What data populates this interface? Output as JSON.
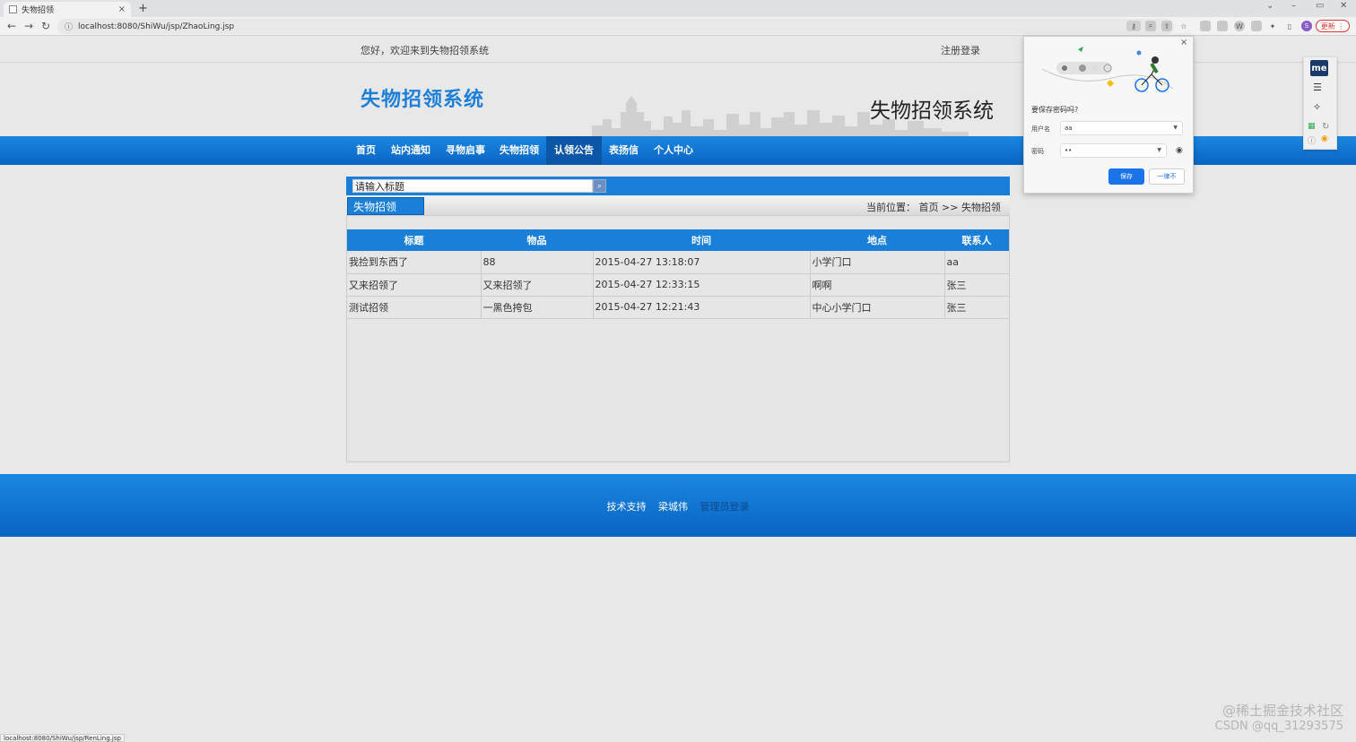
{
  "browser": {
    "tab_title": "失物招领",
    "new_tab": "+",
    "close_tab": "×",
    "window_controls": [
      "⌄",
      "–",
      "▭",
      "✕"
    ],
    "url": "localhost:8080/ShiWu/jsp/ZhaoLing.jsp",
    "update_label": "更新",
    "profile_initial": "S",
    "status_url": "localhost:8080/ShiWu/jsp/RenLing.jsp"
  },
  "header": {
    "welcome": "您好，欢迎来到失物招领系统",
    "register_login": "注册登录",
    "logo": "失物招领系统",
    "banner_title": "失物招领系统"
  },
  "nav": {
    "items": [
      {
        "label": "首页"
      },
      {
        "label": "站内通知"
      },
      {
        "label": "寻物启事"
      },
      {
        "label": "失物招领"
      },
      {
        "label": "认领公告"
      },
      {
        "label": "表扬信"
      },
      {
        "label": "个人中心"
      }
    ],
    "active": "认领公告"
  },
  "search": {
    "value": "请输入标题",
    "button_icon": "search-icon"
  },
  "section": {
    "title": "失物招领",
    "breadcrumb_label": "当前位置：",
    "breadcrumb_home": "首页",
    "breadcrumb_sep": ">>",
    "breadcrumb_current": "失物招领"
  },
  "table": {
    "headers": [
      "标题",
      "物品",
      "时间",
      "地点",
      "联系人"
    ],
    "rows": [
      [
        "我捡到东西了",
        "88",
        "2015-04-27 13:18:07",
        "小学门口",
        "aa"
      ],
      [
        "又来招领了",
        "又来招领了",
        "2015-04-27 12:33:15",
        "啊啊",
        "张三"
      ],
      [
        "测试招领",
        "一黑色挎包",
        "2015-04-27 12:21:43",
        "中心小学门口",
        "张三"
      ]
    ]
  },
  "footer": {
    "support": "技术支持",
    "author": "梁城伟",
    "admin_login": "管理员登录"
  },
  "password_popup": {
    "title": "要保存密码吗?",
    "username_label": "用户名",
    "username_value": "aa",
    "password_label": "密码",
    "password_value": "••",
    "save": "保存",
    "never": "一律不",
    "close": "×"
  },
  "side_tools": {
    "badge": "me"
  },
  "watermark": {
    "line1": "@稀土掘金技术社区",
    "line2": "CSDN @qq_31293575"
  },
  "colors": {
    "brand_blue": "#1a7fd8",
    "nav_active": "#0b56a6",
    "logo_blue": "#1e7fd8"
  }
}
